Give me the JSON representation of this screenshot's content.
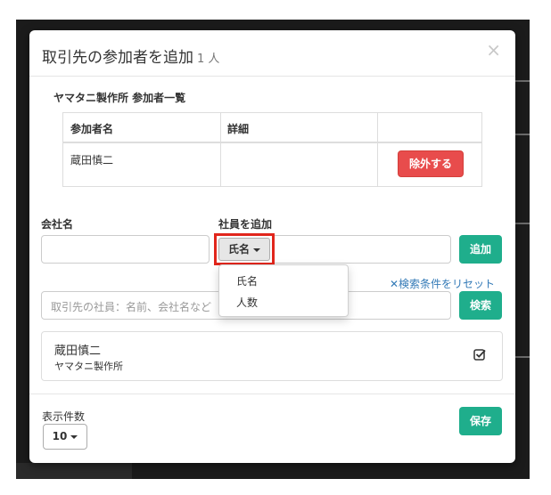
{
  "modal": {
    "title": "取引先の参加者を追加",
    "count": "1 人",
    "close_label": "×"
  },
  "participants": {
    "section_title": "ヤマタニ製作所 参加者一覧",
    "headers": [
      "参加者名",
      "詳細",
      ""
    ],
    "rows": [
      {
        "name": "蔵田慎二",
        "detail": "",
        "action": "除外する"
      }
    ]
  },
  "form": {
    "company_label": "会社名",
    "company_value": "",
    "employee_label": "社員を追加",
    "field_select_label": "氏名",
    "add_button": "追加",
    "reset_link": "✕検索条件をリセット",
    "search_placeholder": "取引先の社員：名前、会社名など",
    "search_button": "検索"
  },
  "dropdown_menu": {
    "items": [
      "氏名",
      "人数"
    ]
  },
  "results": [
    {
      "name": "蔵田慎二",
      "company": "ヤマタニ製作所",
      "checked": true
    }
  ],
  "footer": {
    "page_size_label": "表示件数",
    "page_size_value": "10",
    "save_button": "保存"
  },
  "colors": {
    "accent_green": "#1fae8c",
    "danger_red": "#e84c4c",
    "link_blue": "#337ab7",
    "highlight_red": "#e1261c"
  }
}
